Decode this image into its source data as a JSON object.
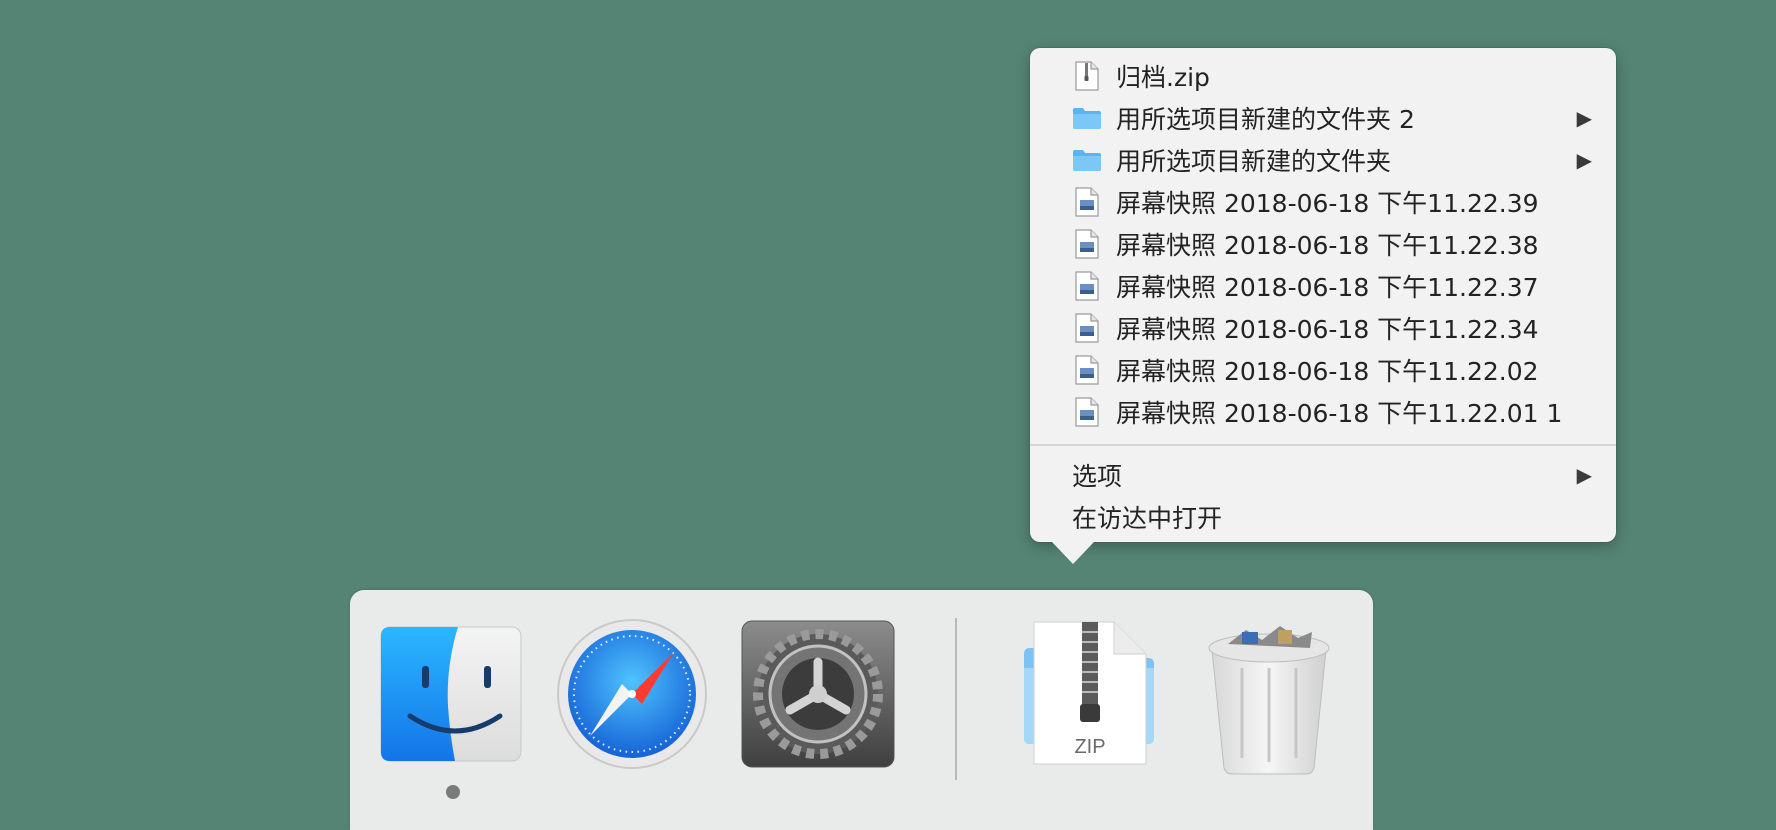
{
  "stack_menu": {
    "files": [
      {
        "icon": "zip-file-icon",
        "label": "归档.zip",
        "has_submenu": false
      },
      {
        "icon": "folder-icon",
        "label": "用所选项目新建的文件夹 2",
        "has_submenu": true
      },
      {
        "icon": "folder-icon",
        "label": "用所选项目新建的文件夹",
        "has_submenu": true
      },
      {
        "icon": "image-file-icon",
        "label": "屏幕快照 2018-06-18 下午11.22.39",
        "has_submenu": false
      },
      {
        "icon": "image-file-icon",
        "label": "屏幕快照 2018-06-18 下午11.22.38",
        "has_submenu": false
      },
      {
        "icon": "image-file-icon",
        "label": "屏幕快照 2018-06-18 下午11.22.37",
        "has_submenu": false
      },
      {
        "icon": "image-file-icon",
        "label": "屏幕快照 2018-06-18 下午11.22.34",
        "has_submenu": false
      },
      {
        "icon": "image-file-icon",
        "label": "屏幕快照 2018-06-18 下午11.22.02",
        "has_submenu": false
      },
      {
        "icon": "image-file-icon",
        "label": "屏幕快照 2018-06-18 下午11.22.01 1",
        "has_submenu": false
      }
    ],
    "options_label": "选项",
    "open_in_finder_label": "在访达中打开",
    "submenu_arrow": "▶"
  },
  "dock": {
    "items": [
      {
        "name": "finder",
        "icon": "finder-icon",
        "running": true
      },
      {
        "name": "safari",
        "icon": "safari-compass-icon",
        "running": false
      },
      {
        "name": "system-preferences",
        "icon": "gear-icon",
        "running": false
      },
      {
        "name": "downloads-stack",
        "icon": "zip-stack-icon",
        "running": false
      },
      {
        "name": "trash",
        "icon": "trash-icon",
        "running": false
      }
    ],
    "zip_stack_label": "ZIP"
  },
  "colors": {
    "desktop": "#558474",
    "menu_bg": "#f2f2f2",
    "folder_blue": "#5ab4ef",
    "finder_blue": "#1e8ff0",
    "safari_blue": "#1a8ae6"
  }
}
